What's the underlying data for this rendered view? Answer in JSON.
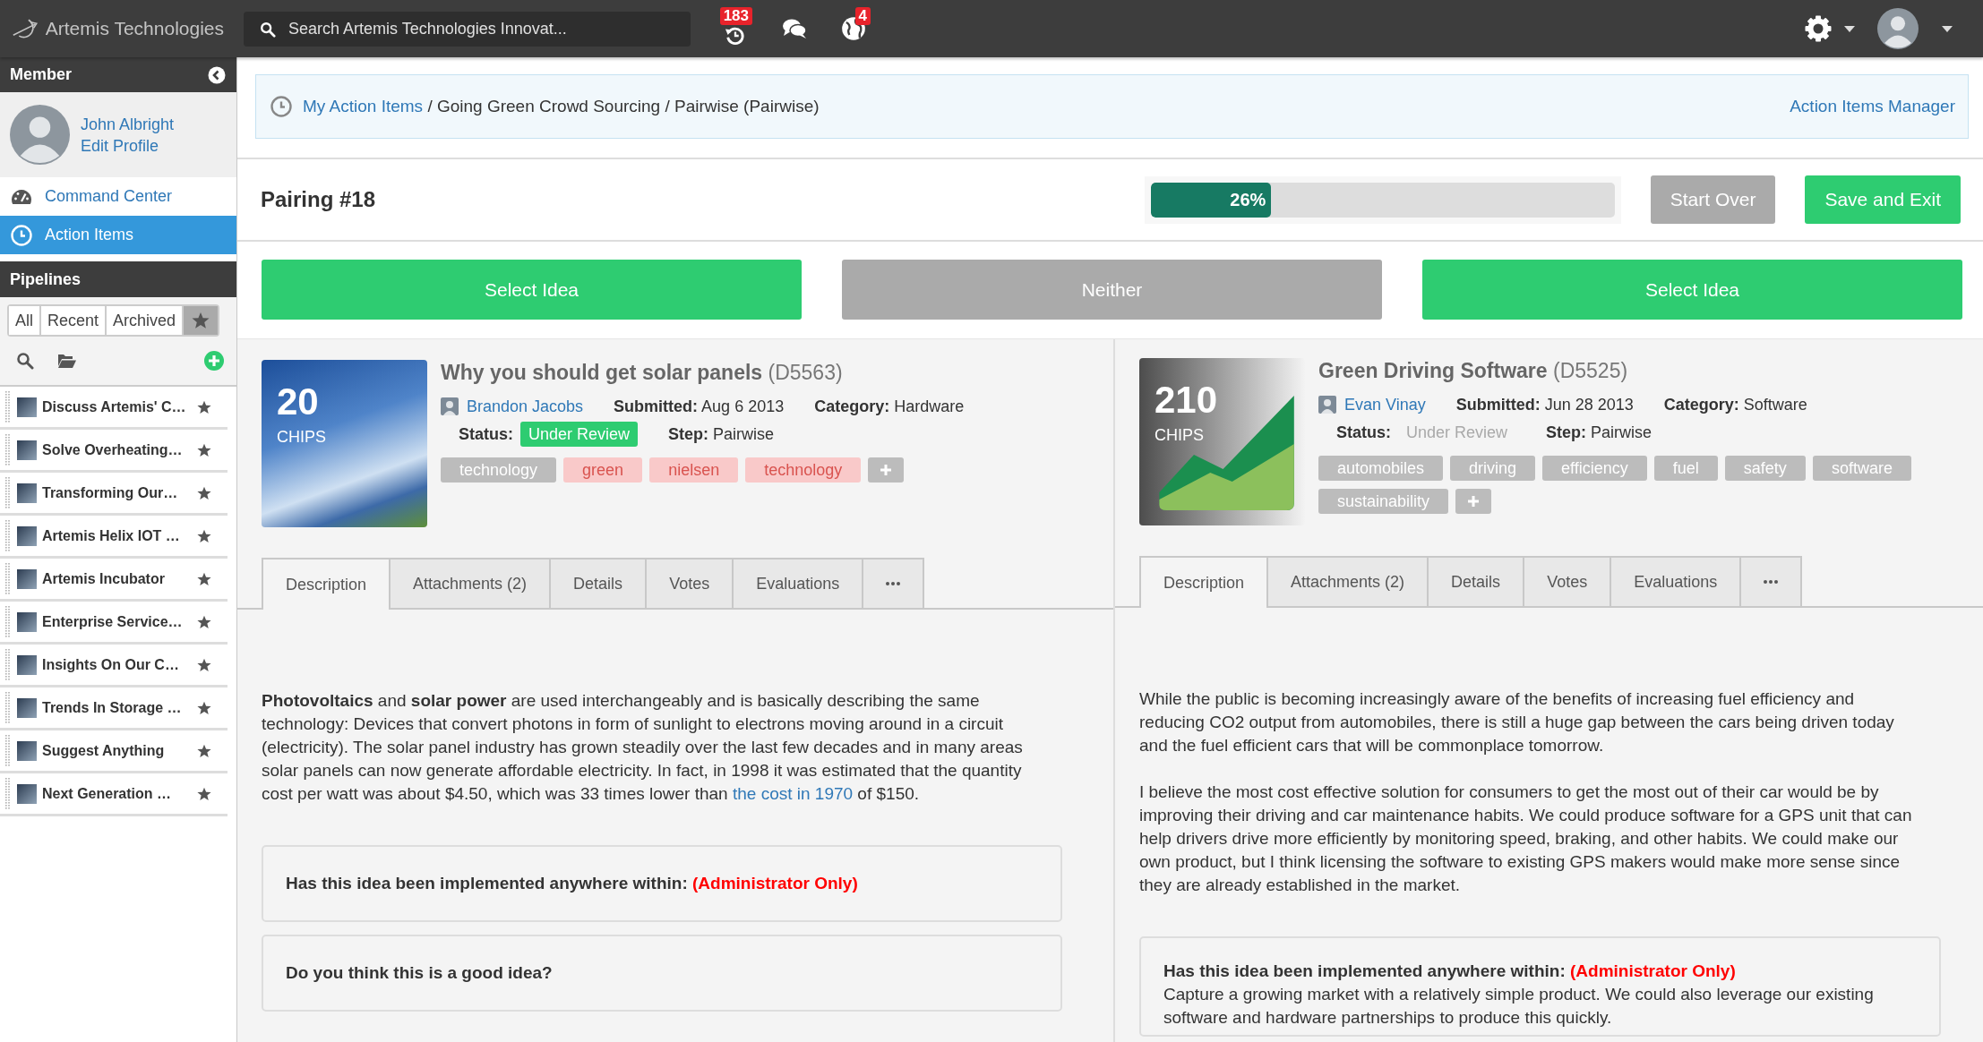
{
  "topbar": {
    "brand": "Artemis Technologies",
    "search": {
      "placeholder": "Search Artemis Technologies Innovat..."
    },
    "notifications": [
      {
        "kind": "history",
        "count": "183"
      },
      {
        "kind": "chat"
      },
      {
        "kind": "globe",
        "count": "4"
      }
    ]
  },
  "sidebar": {
    "member": {
      "title": "Member",
      "name": "John Albright",
      "edit_link": "Edit Profile"
    },
    "nav": [
      {
        "kind": "dashboard",
        "label": "Command Center",
        "selected": false
      },
      {
        "kind": "clock",
        "label": "Action Items",
        "selected": true
      }
    ],
    "pipelines": {
      "title": "Pipelines",
      "filters": [
        {
          "kind": "text",
          "label": "All",
          "selected": false
        },
        {
          "kind": "text",
          "label": "Recent",
          "selected": false
        },
        {
          "kind": "text",
          "label": "Archived",
          "selected": false
        },
        {
          "kind": "star",
          "selected": true
        }
      ],
      "items": [
        {
          "name": "Discuss Artemis' C…"
        },
        {
          "name": "Solve Overheating…"
        },
        {
          "name": "Transforming Our…"
        },
        {
          "name": "Artemis Helix IOT …"
        },
        {
          "name": "Artemis Incubator"
        },
        {
          "name": "Enterprise Service…"
        },
        {
          "name": "Insights On Our C…"
        },
        {
          "name": "Trends In Storage …"
        },
        {
          "name": "Suggest Anything"
        },
        {
          "name": "Next Generation …"
        }
      ]
    }
  },
  "breadcrumb": {
    "link": "My Action Items",
    "trail": "/ Going Green Crowd Sourcing / Pairwise (Pairwise)",
    "manager_link": "Action Items Manager"
  },
  "pairing": {
    "title": "Pairing #18",
    "progress": {
      "level": 0.26,
      "label": "26%"
    },
    "buttons": [
      {
        "kind": "secondary",
        "label": "Start Over"
      },
      {
        "kind": "primary",
        "label": "Save and Exit"
      }
    ]
  },
  "choices": [
    {
      "kind": "select",
      "label": "Select Idea"
    },
    {
      "kind": "skip",
      "label": "Neither"
    },
    {
      "kind": "select",
      "label": "Select Idea"
    }
  ],
  "ideas": [
    {
      "image": {
        "kind": "photo",
        "chips": "20",
        "chips_label": "CHIPS"
      },
      "title": "Why you should get solar panels",
      "code": "(D5563)",
      "author": "Brandon Jacobs",
      "submitted_label": "Submitted:",
      "submitted": "Aug 6 2013",
      "category_label": "Category:",
      "category": "Hardware",
      "status_label": "Status:",
      "status": {
        "label": "Under Review",
        "highlighted": true
      },
      "step_label": "Step:",
      "step": "Pairwise",
      "tags": [
        {
          "label": "technology",
          "highlighted": false
        },
        {
          "label": "green",
          "highlighted": true
        },
        {
          "label": "nielsen",
          "highlighted": true
        },
        {
          "label": "technology",
          "highlighted": true
        }
      ],
      "tabs": [
        {
          "kind": "text",
          "label": "Description",
          "selected": true
        },
        {
          "kind": "text",
          "label": "Attachments (2)",
          "selected": false
        },
        {
          "kind": "text",
          "label": "Details",
          "selected": false
        },
        {
          "kind": "text",
          "label": "Votes",
          "selected": false
        },
        {
          "kind": "text",
          "label": "Evaluations",
          "selected": false
        },
        {
          "kind": "more",
          "selected": false
        }
      ],
      "description": [
        {
          "parts": [
            {
              "kind": "text",
              "text": "**Photovoltaics** and **solar power** are used interchangeably and is basically describing the same technology: Devices that convert photons in form of sunlight to electrons moving around in a circuit (electricity). The solar panel industry has grown steadily over the last few decades and in many areas solar panels can now generate affordable electricity. In fact, in 1998 it was estimated that the quantity cost per watt was about $4.50, which was 33 times lower than "
            },
            {
              "kind": "link",
              "text": "the cost in 1970"
            },
            {
              "kind": "text",
              "text": " of $150."
            }
          ]
        }
      ],
      "questions": [
        {
          "question": "Has this idea been implemented anywhere within:",
          "note": "(Administrator Only)"
        },
        {
          "question": "Do you think this is a good idea?"
        }
      ]
    },
    {
      "image": {
        "kind": "chart",
        "chips": "210",
        "chips_label": "CHIPS"
      },
      "title": "Green Driving Software",
      "code": "(D5525)",
      "author": "Evan Vinay",
      "submitted_label": "Submitted:",
      "submitted": "Jun 28 2013",
      "category_label": "Category:",
      "category": "Software",
      "status_label": "Status:",
      "status": {
        "label": "Under Review",
        "highlighted": false
      },
      "step_label": "Step:",
      "step": "Pairwise",
      "tags": [
        {
          "label": "automobiles",
          "highlighted": false
        },
        {
          "label": "driving",
          "highlighted": false
        },
        {
          "label": "efficiency",
          "highlighted": false
        },
        {
          "label": "fuel",
          "highlighted": false
        },
        {
          "label": "safety",
          "highlighted": false
        },
        {
          "label": "software",
          "highlighted": false
        },
        {
          "label": "sustainability",
          "highlighted": false
        }
      ],
      "tabs": [
        {
          "kind": "text",
          "label": "Description",
          "selected": true
        },
        {
          "kind": "text",
          "label": "Attachments (2)",
          "selected": false
        },
        {
          "kind": "text",
          "label": "Details",
          "selected": false
        },
        {
          "kind": "text",
          "label": "Votes",
          "selected": false
        },
        {
          "kind": "text",
          "label": "Evaluations",
          "selected": false
        },
        {
          "kind": "more",
          "selected": false
        }
      ],
      "description": [
        {
          "parts": [
            {
              "kind": "text",
              "text": "While the public is becoming increasingly aware of the benefits of increasing fuel efficiency and reducing CO2 output from automobiles, there is still a huge gap between the cars being driven today and the fuel efficient cars that will be commonplace tomorrow."
            }
          ]
        },
        {
          "parts": [
            {
              "kind": "text",
              "text": "I believe the most cost effective solution for consumers to get the most out of their car would be by improving their driving and car maintenance habits. We could produce software for a GPS unit that can help drivers drive more efficiently by monitoring speed, braking, and other habits. We could make our own product, but I think licensing the software to existing GPS makers would make more sense since they are already established in the market."
            }
          ]
        }
      ],
      "questions": [
        {
          "question": "Has this idea been implemented anywhere within:",
          "note": "(Administrator Only)",
          "answer": "Capture a growing market with a relatively simple product. We could also leverage our existing software and hardware partnerships to produce this quickly."
        }
      ]
    }
  ]
}
